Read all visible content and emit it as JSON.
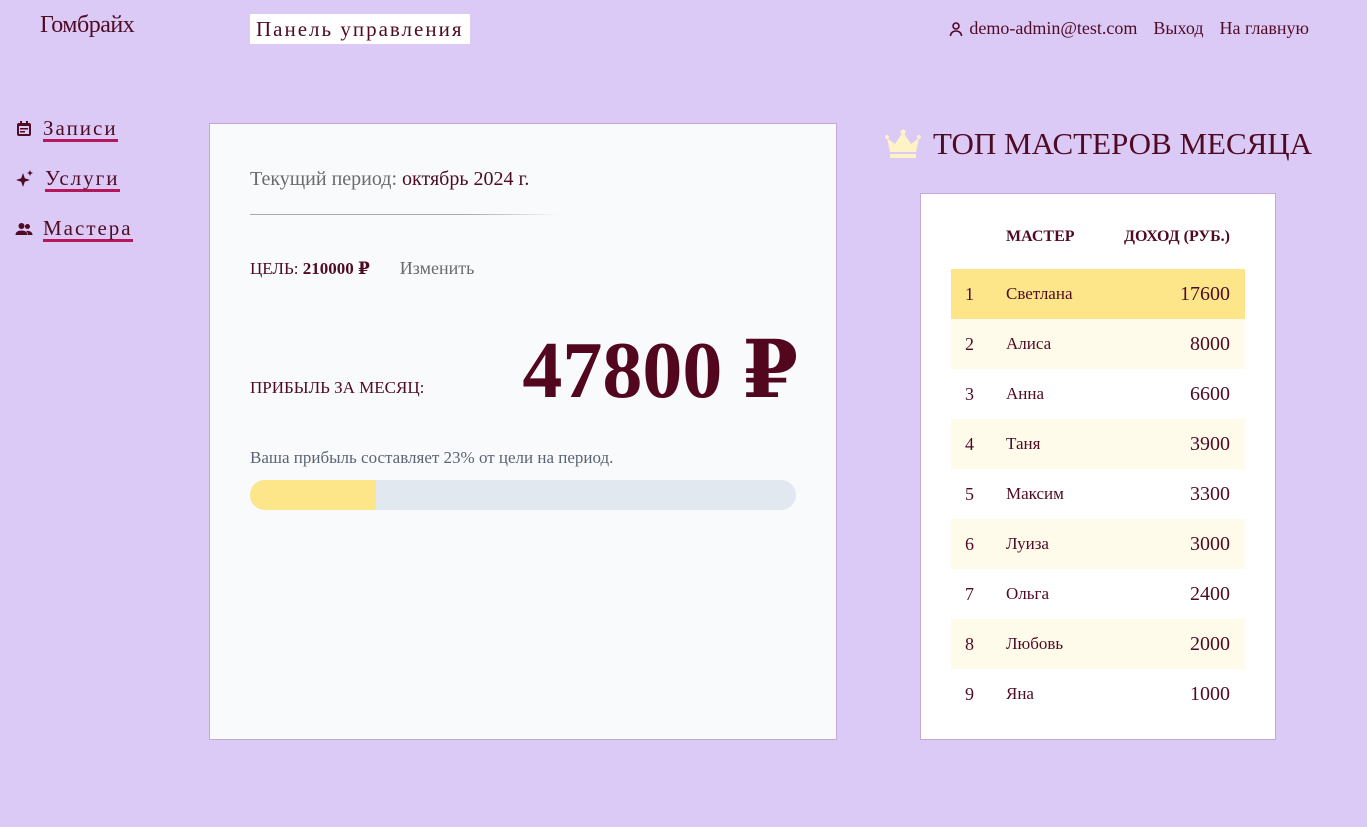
{
  "header": {
    "logo": "Гомбрайх",
    "panel_title": "Панель управления",
    "user_email": "demo-admin@test.com",
    "logout": "Выход",
    "home": "На главную"
  },
  "sidebar": {
    "items": [
      {
        "label": "Записи",
        "icon": "calendar-icon"
      },
      {
        "label": "Услуги",
        "icon": "sparkles-icon"
      },
      {
        "label": "Мастера",
        "icon": "users-icon"
      }
    ]
  },
  "summary": {
    "period_label": "Текущий период:",
    "period_value": "октябрь 2024 г.",
    "goal_label": "ЦЕЛЬ:",
    "goal_value": "210000 ₽",
    "edit": "Изменить",
    "profit_label": "ПРИБЫЛЬ ЗА МЕСЯЦ:",
    "profit_value": "47800 ₽",
    "progress_text": "Ваша прибыль составляет 23% от цели на период.",
    "progress_percent": 23
  },
  "top": {
    "title": "ТОП МАСТЕРОВ МЕСЯЦА",
    "col_master": "МАСТЕР",
    "col_income": "ДОХОД (РУБ.)",
    "rows": [
      [
        "1",
        "Светлана",
        "17600"
      ],
      [
        "2",
        "Алиса",
        "8000"
      ],
      [
        "3",
        "Анна",
        "6600"
      ],
      [
        "4",
        "Таня",
        "3900"
      ],
      [
        "5",
        "Максим",
        "3300"
      ],
      [
        "6",
        "Луиза",
        "3000"
      ],
      [
        "7",
        "Ольга",
        "2400"
      ],
      [
        "8",
        "Любовь",
        "2000"
      ],
      [
        "9",
        "Яна",
        "1000"
      ]
    ]
  },
  "colors": {
    "background": "#dccaf6",
    "accent": "#4f0a24",
    "highlight": "#fde68a",
    "stripe": "#fffbeb"
  }
}
